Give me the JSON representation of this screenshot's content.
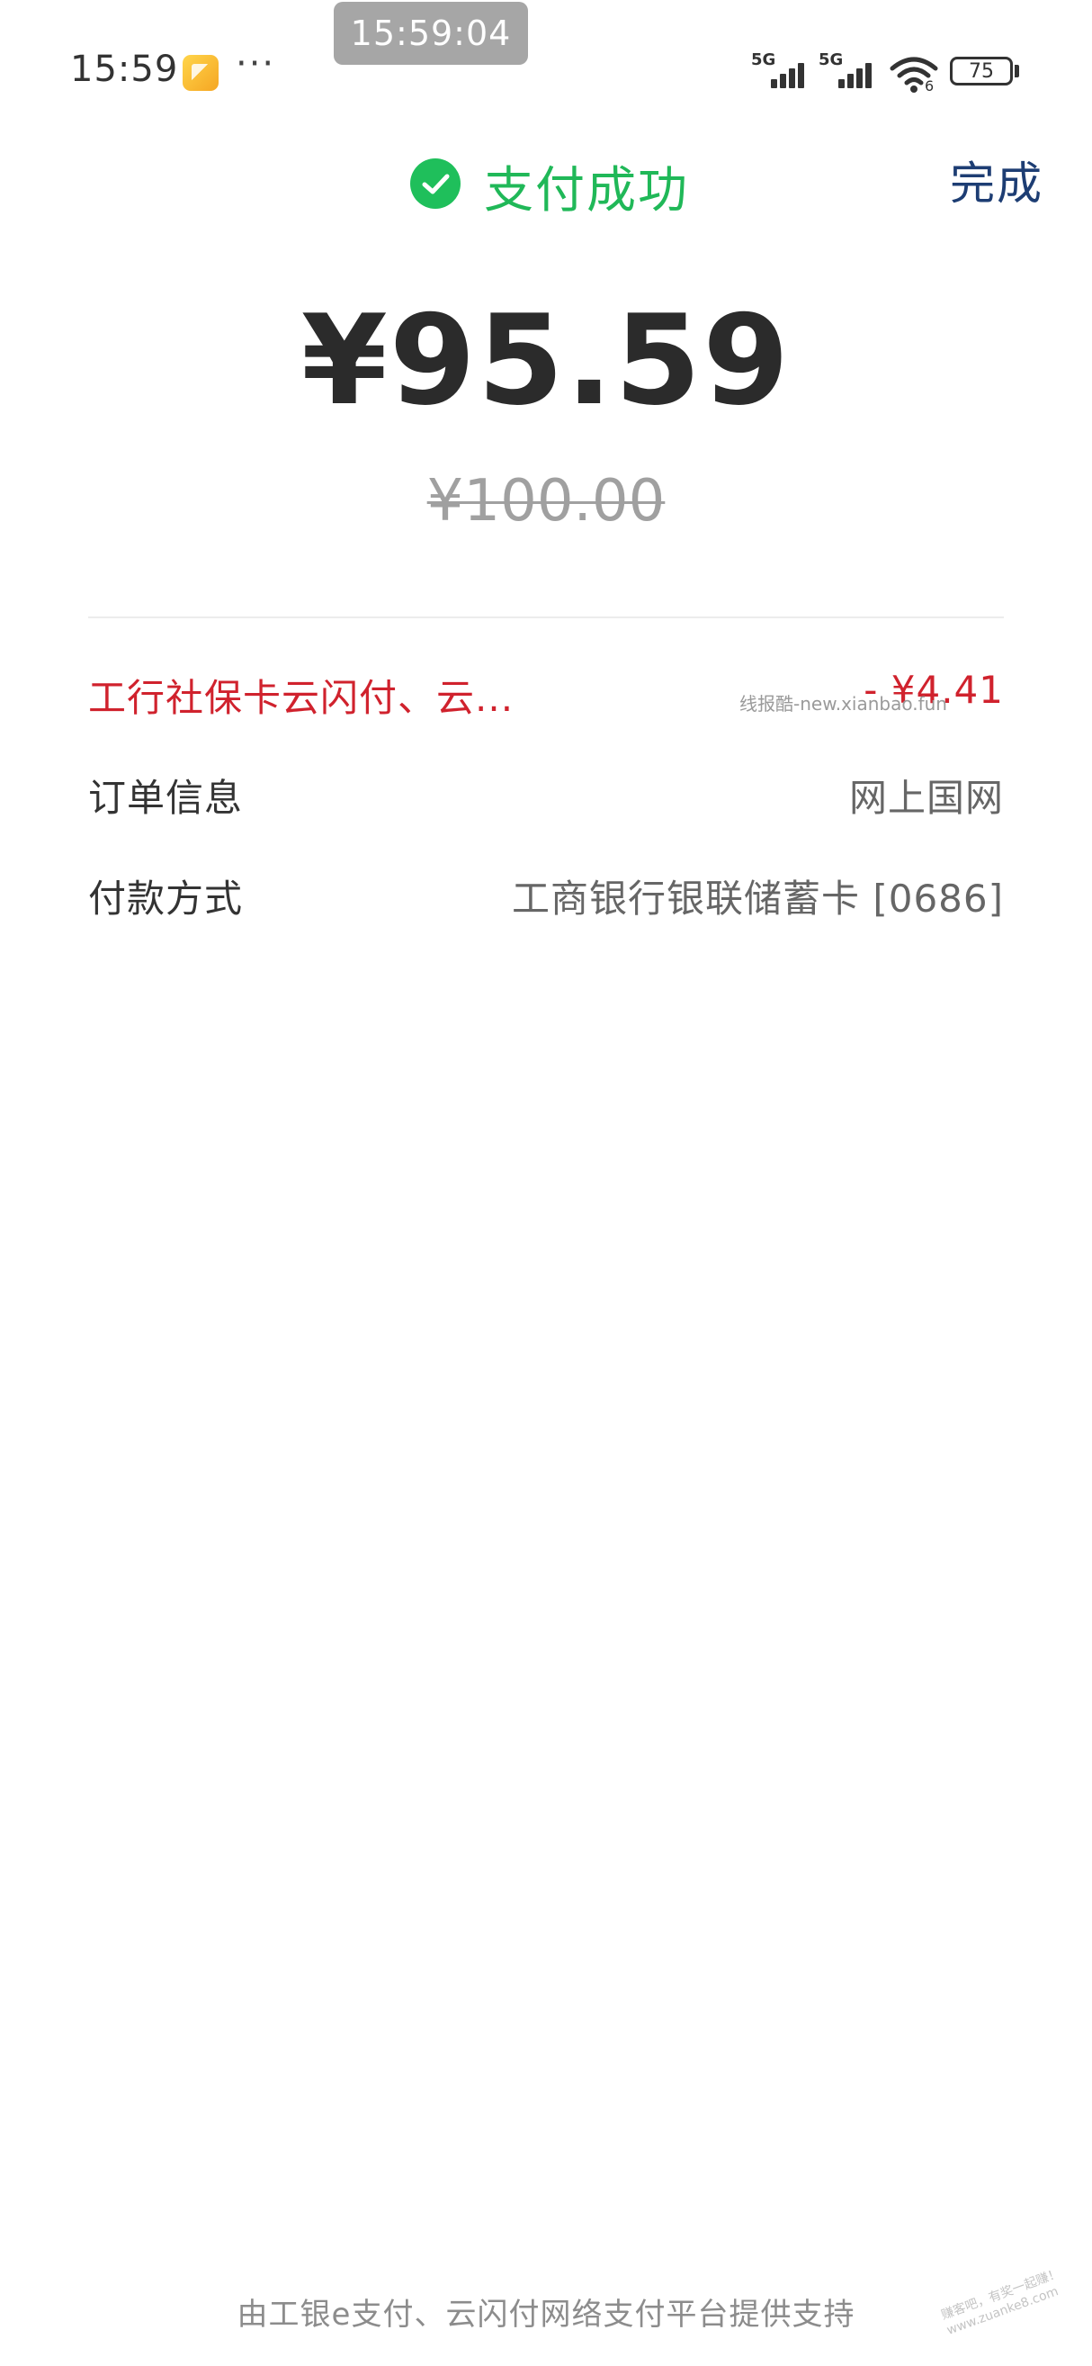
{
  "status_bar": {
    "time": "15:59",
    "more_indicator": "···",
    "screenshot_time": "15:59:04",
    "sim1_network": "5G",
    "sim2_network": "5G",
    "wifi_sub": "6",
    "battery_level": "75"
  },
  "header": {
    "title": "支付成功",
    "done_label": "完成"
  },
  "amount": {
    "paid": "¥95.59",
    "original": "¥100.00"
  },
  "details": {
    "discount": {
      "label": "工行社保卡云闪付、云...",
      "value": "- ¥4.41"
    },
    "order": {
      "label": "订单信息",
      "value": "网上国网"
    },
    "payment": {
      "label": "付款方式",
      "value": "工商银行银联储蓄卡 [0686]"
    }
  },
  "watermark": "线报酷-new.xianbao.fun",
  "corner_watermark": {
    "line1": "赚客吧，有奖一起赚！",
    "line2": "www.zuanke8.com"
  },
  "footer": {
    "text": "由工银e支付、云闪付网络支付平台提供支持"
  },
  "colors": {
    "success_green": "#20b858",
    "done_blue": "#1d3d73",
    "discount_red": "#d0222d"
  }
}
